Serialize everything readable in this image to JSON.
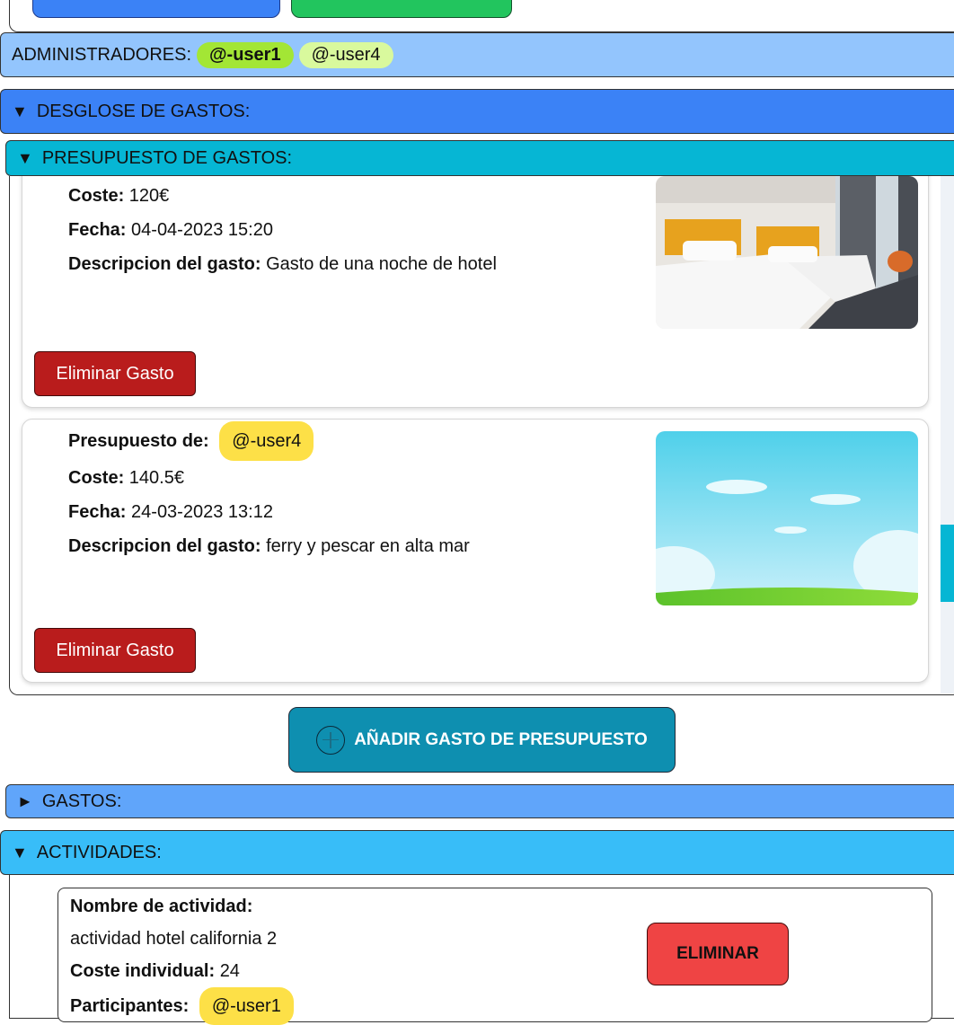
{
  "admins": {
    "label": "ADMINISTRADORES:",
    "users": [
      "@-user1",
      "@-user4"
    ]
  },
  "sections": {
    "desglose": {
      "arrow": "▼",
      "label": "DESGLOSE DE GASTOS:"
    },
    "presupuesto": {
      "arrow": "▼",
      "label": "PRESUPUESTO DE GASTOS:"
    },
    "gastos": {
      "arrow": "►",
      "label": "GASTOS:"
    },
    "actividades": {
      "arrow": "▼",
      "label": "ACTIVIDADES:"
    }
  },
  "expenses": [
    {
      "cost_label": "Coste:",
      "cost": "120€",
      "date_label": "Fecha:",
      "date": "04-04-2023 15:20",
      "desc_label": "Descripcion del gasto:",
      "desc": "Gasto de una noche de hotel",
      "delete_label": "Eliminar Gasto"
    },
    {
      "owner_label": "Presupuesto de:",
      "owner": "@-user4",
      "cost_label": "Coste:",
      "cost": "140.5€",
      "date_label": "Fecha:",
      "date": "24-03-2023 13:12",
      "desc_label": "Descripcion del gasto:",
      "desc": "ferry y pescar en alta mar",
      "delete_label": "Eliminar Gasto"
    }
  ],
  "add_button": {
    "label": "AÑADIR GASTO DE PRESUPUESTO",
    "icon": "plus-circle-icon"
  },
  "activity": {
    "name_label": "Nombre de actividad:",
    "name": "actividad hotel california 2",
    "cost_label": "Coste individual:",
    "cost": "24",
    "participants_label": "Participantes:",
    "participants": [
      "@-user1"
    ],
    "delete_label": "ELIMINAR"
  },
  "colors": {
    "admin_bar": "#93c5fd",
    "desglose": "#3b82f6",
    "presupuesto": "#06b6d4",
    "gastos": "#60a5fa",
    "actividades": "#38bdf8",
    "delete": "#b91c1c",
    "add": "#0e8fb0"
  }
}
